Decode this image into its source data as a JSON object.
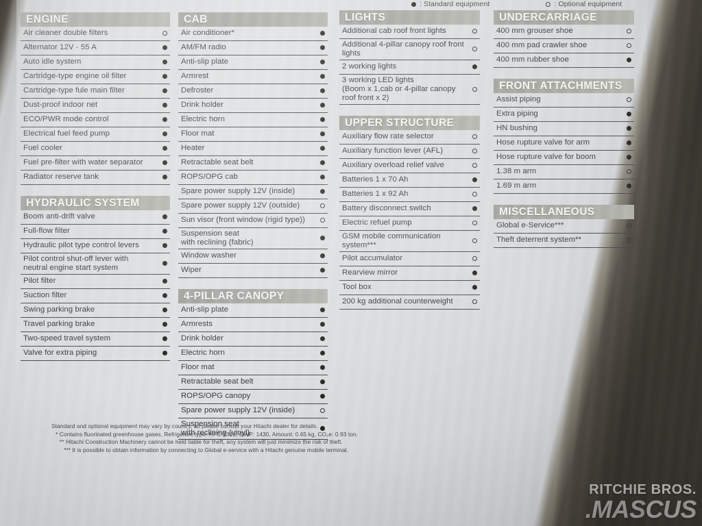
{
  "legend": {
    "standard": ": Standard equipment",
    "optional": ": Optional equipment"
  },
  "columns": [
    {
      "id": "col1",
      "sections": [
        {
          "title": "ENGINE",
          "rows": [
            {
              "label": "Air cleaner double filters",
              "mark": "optional"
            },
            {
              "label": "Alternator 12V - 55 A",
              "mark": "standard"
            },
            {
              "label": "Auto idle system",
              "mark": "standard"
            },
            {
              "label": "Cartridge-type engine oil filter",
              "mark": "standard"
            },
            {
              "label": "Cartridge-type fule main filter",
              "mark": "standard"
            },
            {
              "label": "Dust-proof indoor net",
              "mark": "standard"
            },
            {
              "label": "ECO/PWR mode control",
              "mark": "standard"
            },
            {
              "label": "Electrical fuel feed pump",
              "mark": "standard"
            },
            {
              "label": "Fuel cooler",
              "mark": "standard"
            },
            {
              "label": "Fuel pre-filter with water separator",
              "mark": "standard"
            },
            {
              "label": "Radiator reserve tank",
              "mark": "standard"
            }
          ]
        },
        {
          "title": "HYDRAULIC SYSTEM",
          "rows": [
            {
              "label": "Boom anti-drift valve",
              "mark": "standard"
            },
            {
              "label": "Full-flow filter",
              "mark": "standard"
            },
            {
              "label": "Hydraulic pilot type control levers",
              "mark": "standard"
            },
            {
              "label": "Pilot control shut-off lever with\nneutral engine start system",
              "mark": "standard",
              "lines": 2
            },
            {
              "label": "Pilot filter",
              "mark": "standard"
            },
            {
              "label": "Suction filter",
              "mark": "standard"
            },
            {
              "label": "Swing parking brake",
              "mark": "standard"
            },
            {
              "label": "Travel parking brake",
              "mark": "standard"
            },
            {
              "label": "Two-speed travel system",
              "mark": "standard"
            },
            {
              "label": "Valve for extra piping",
              "mark": "standard"
            }
          ]
        }
      ]
    },
    {
      "id": "col2",
      "sections": [
        {
          "title": "CAB",
          "rows": [
            {
              "label": "Air conditioner*",
              "mark": "standard"
            },
            {
              "label": "AM/FM radio",
              "mark": "standard"
            },
            {
              "label": "Anti-slip plate",
              "mark": "standard"
            },
            {
              "label": "Armrest",
              "mark": "standard"
            },
            {
              "label": "Defroster",
              "mark": "standard"
            },
            {
              "label": "Drink holder",
              "mark": "standard"
            },
            {
              "label": "Electric horn",
              "mark": "standard"
            },
            {
              "label": "Floor mat",
              "mark": "standard"
            },
            {
              "label": "Heater",
              "mark": "standard"
            },
            {
              "label": "Retractable seat belt",
              "mark": "standard"
            },
            {
              "label": "ROPS/OPG cab",
              "mark": "standard"
            },
            {
              "label": "Spare power supply 12V (inside)",
              "mark": "standard"
            },
            {
              "label": "Spare power supply 12V (outside)",
              "mark": "optional"
            },
            {
              "label": "Sun visor (front window (rigid type))",
              "mark": "optional"
            },
            {
              "label": "Suspension seat\nwith reclining (fabric)",
              "mark": "standard",
              "lines": 2
            },
            {
              "label": "Window washer",
              "mark": "standard"
            },
            {
              "label": "Wiper",
              "mark": "standard"
            }
          ]
        },
        {
          "title": "4-PILLAR CANOPY",
          "rows": [
            {
              "label": "Anti-slip plate",
              "mark": "standard"
            },
            {
              "label": "Armrests",
              "mark": "standard"
            },
            {
              "label": "Drink holder",
              "mark": "standard"
            },
            {
              "label": "Electric horn",
              "mark": "standard"
            },
            {
              "label": "Floor mat",
              "mark": "standard"
            },
            {
              "label": "Retractable seat belt",
              "mark": "standard"
            },
            {
              "label": "ROPS/OPG canopy",
              "mark": "standard"
            },
            {
              "label": "Spare power supply 12V (inside)",
              "mark": "optional"
            },
            {
              "label": "Suspension seat\nwith reclining (vinyl)",
              "mark": "standard",
              "lines": 2
            }
          ]
        }
      ]
    },
    {
      "id": "col3",
      "sections": [
        {
          "title": "LIGHTS",
          "rows": [
            {
              "label": "Additional cab roof front lights",
              "mark": "optional"
            },
            {
              "label": "Additional 4-pillar canopy roof front\nlights",
              "mark": "optional",
              "lines": 2
            },
            {
              "label": "2 working lights",
              "mark": "standard"
            },
            {
              "label": "3 working LED lights\n(Boom x 1,cab or 4-pillar canopy\nroof front x 2)",
              "mark": "optional",
              "lines": 3
            }
          ]
        },
        {
          "title": "UPPER STRUCTURE",
          "rows": [
            {
              "label": "Auxiliary flow rate selector",
              "mark": "optional"
            },
            {
              "label": "Auxiliary function lever (AFL)",
              "mark": "optional"
            },
            {
              "label": "Auxiliary overload relief valve",
              "mark": "optional"
            },
            {
              "label": "Batteries 1 x 70 Ah",
              "mark": "standard"
            },
            {
              "label": "Batteries 1 x 92 Ah",
              "mark": "optional"
            },
            {
              "label": "Battery disconnect switch",
              "mark": "standard"
            },
            {
              "label": "Electric refuel pump",
              "mark": "optional"
            },
            {
              "label": "GSM mobile communication\nsystem***",
              "mark": "optional",
              "lines": 2
            },
            {
              "label": "Pilot accumulator",
              "mark": "optional"
            },
            {
              "label": "Rearview mirror",
              "mark": "standard"
            },
            {
              "label": "Tool box",
              "mark": "standard"
            },
            {
              "label": "200 kg additional counterweight",
              "mark": "optional"
            }
          ]
        }
      ]
    },
    {
      "id": "col4",
      "sections": [
        {
          "title": "UNDERCARRIAGE",
          "rows": [
            {
              "label": "400 mm grouser shoe",
              "mark": "optional"
            },
            {
              "label": "400 mm pad crawler shoe",
              "mark": "optional"
            },
            {
              "label": "400 mm rubber shoe",
              "mark": "standard"
            }
          ]
        },
        {
          "title": "FRONT ATTACHMENTS",
          "rows": [
            {
              "label": "Assist piping",
              "mark": "optional"
            },
            {
              "label": "Extra piping",
              "mark": "standard"
            },
            {
              "label": "HN bushing",
              "mark": "standard"
            },
            {
              "label": "Hose rupture valve for arm",
              "mark": "standard"
            },
            {
              "label": "Hose rupture valve for boom",
              "mark": "standard"
            },
            {
              "label": "1.38 m arm",
              "mark": "optional"
            },
            {
              "label": "1.69 m arm",
              "mark": "standard"
            }
          ]
        },
        {
          "title": "MISCELLANEOUS",
          "rows": [
            {
              "label": "Global e-Service***",
              "mark": "optional"
            },
            {
              "label": "Theft deterrent system**",
              "mark": "optional"
            }
          ]
        }
      ]
    }
  ],
  "footnotes": [
    {
      "text": "Standard and optional equipment may vary by country, so please consult your Hitachi dealer for details.",
      "indent": 0
    },
    {
      "text": "* Contains fluorinated greenhouse gases, Refrigerant type: HFC-134a, GWP: 1430, Amount: 0.65 kg, CO₂e: 0.93 ton.",
      "indent": 1
    },
    {
      "text": "** Hitachi Construction Machinery cannot be held liable for theft, any system will just minimize the risk of theft.",
      "indent": 2
    },
    {
      "text": "*** It is possible to obtain information by connecting to Global e-service with a Hitachi genuine mobile terminal.",
      "indent": 3
    }
  ],
  "watermark": {
    "top": "RITCHIE BROS.",
    "bottom": ".MASCUS"
  },
  "colors": {
    "section_header_bg": "#a0a09a",
    "section_header_text": "#f3f3ef",
    "row_text": "#2e3033",
    "row_rule": "#3f4246",
    "page_bg": "#d8dadc",
    "dark_edge": "#3c3a33"
  }
}
